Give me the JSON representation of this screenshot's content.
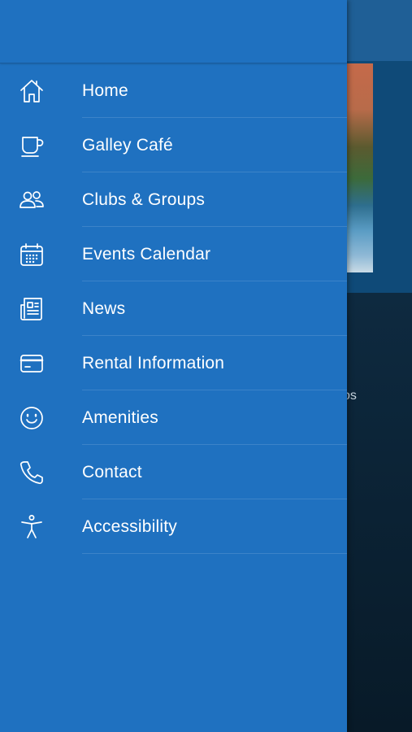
{
  "background": {
    "peek_text": "os"
  },
  "drawer": {
    "items": [
      {
        "label": "Home",
        "icon": "home-icon"
      },
      {
        "label": "Galley Café",
        "icon": "cup-icon"
      },
      {
        "label": "Clubs & Groups",
        "icon": "people-icon"
      },
      {
        "label": "Events Calendar",
        "icon": "calendar-icon"
      },
      {
        "label": "News",
        "icon": "newspaper-icon"
      },
      {
        "label": "Rental Information",
        "icon": "card-icon"
      },
      {
        "label": "Amenities",
        "icon": "smiley-icon"
      },
      {
        "label": "Contact",
        "icon": "phone-icon"
      },
      {
        "label": "Accessibility",
        "icon": "accessibility-icon"
      }
    ]
  },
  "colors": {
    "drawer_bg": "#1f71c0",
    "text": "#ffffff",
    "backdrop": "#0a1e2e"
  }
}
